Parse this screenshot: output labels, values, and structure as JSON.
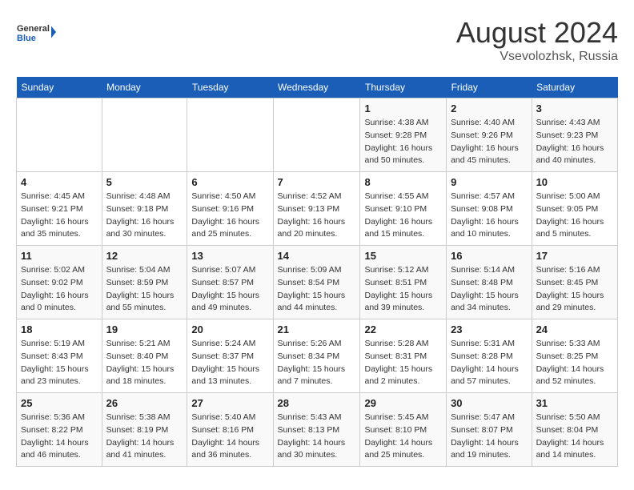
{
  "header": {
    "logo_general": "General",
    "logo_blue": "Blue",
    "month_year": "August 2024",
    "location": "Vsevolozhsk, Russia"
  },
  "days_of_week": [
    "Sunday",
    "Monday",
    "Tuesday",
    "Wednesday",
    "Thursday",
    "Friday",
    "Saturday"
  ],
  "weeks": [
    [
      {
        "day": "",
        "info": ""
      },
      {
        "day": "",
        "info": ""
      },
      {
        "day": "",
        "info": ""
      },
      {
        "day": "",
        "info": ""
      },
      {
        "day": "1",
        "info": "Sunrise: 4:38 AM\nSunset: 9:28 PM\nDaylight: 16 hours\nand 50 minutes."
      },
      {
        "day": "2",
        "info": "Sunrise: 4:40 AM\nSunset: 9:26 PM\nDaylight: 16 hours\nand 45 minutes."
      },
      {
        "day": "3",
        "info": "Sunrise: 4:43 AM\nSunset: 9:23 PM\nDaylight: 16 hours\nand 40 minutes."
      }
    ],
    [
      {
        "day": "4",
        "info": "Sunrise: 4:45 AM\nSunset: 9:21 PM\nDaylight: 16 hours\nand 35 minutes."
      },
      {
        "day": "5",
        "info": "Sunrise: 4:48 AM\nSunset: 9:18 PM\nDaylight: 16 hours\nand 30 minutes."
      },
      {
        "day": "6",
        "info": "Sunrise: 4:50 AM\nSunset: 9:16 PM\nDaylight: 16 hours\nand 25 minutes."
      },
      {
        "day": "7",
        "info": "Sunrise: 4:52 AM\nSunset: 9:13 PM\nDaylight: 16 hours\nand 20 minutes."
      },
      {
        "day": "8",
        "info": "Sunrise: 4:55 AM\nSunset: 9:10 PM\nDaylight: 16 hours\nand 15 minutes."
      },
      {
        "day": "9",
        "info": "Sunrise: 4:57 AM\nSunset: 9:08 PM\nDaylight: 16 hours\nand 10 minutes."
      },
      {
        "day": "10",
        "info": "Sunrise: 5:00 AM\nSunset: 9:05 PM\nDaylight: 16 hours\nand 5 minutes."
      }
    ],
    [
      {
        "day": "11",
        "info": "Sunrise: 5:02 AM\nSunset: 9:02 PM\nDaylight: 16 hours\nand 0 minutes."
      },
      {
        "day": "12",
        "info": "Sunrise: 5:04 AM\nSunset: 8:59 PM\nDaylight: 15 hours\nand 55 minutes."
      },
      {
        "day": "13",
        "info": "Sunrise: 5:07 AM\nSunset: 8:57 PM\nDaylight: 15 hours\nand 49 minutes."
      },
      {
        "day": "14",
        "info": "Sunrise: 5:09 AM\nSunset: 8:54 PM\nDaylight: 15 hours\nand 44 minutes."
      },
      {
        "day": "15",
        "info": "Sunrise: 5:12 AM\nSunset: 8:51 PM\nDaylight: 15 hours\nand 39 minutes."
      },
      {
        "day": "16",
        "info": "Sunrise: 5:14 AM\nSunset: 8:48 PM\nDaylight: 15 hours\nand 34 minutes."
      },
      {
        "day": "17",
        "info": "Sunrise: 5:16 AM\nSunset: 8:45 PM\nDaylight: 15 hours\nand 29 minutes."
      }
    ],
    [
      {
        "day": "18",
        "info": "Sunrise: 5:19 AM\nSunset: 8:43 PM\nDaylight: 15 hours\nand 23 minutes."
      },
      {
        "day": "19",
        "info": "Sunrise: 5:21 AM\nSunset: 8:40 PM\nDaylight: 15 hours\nand 18 minutes."
      },
      {
        "day": "20",
        "info": "Sunrise: 5:24 AM\nSunset: 8:37 PM\nDaylight: 15 hours\nand 13 minutes."
      },
      {
        "day": "21",
        "info": "Sunrise: 5:26 AM\nSunset: 8:34 PM\nDaylight: 15 hours\nand 7 minutes."
      },
      {
        "day": "22",
        "info": "Sunrise: 5:28 AM\nSunset: 8:31 PM\nDaylight: 15 hours\nand 2 minutes."
      },
      {
        "day": "23",
        "info": "Sunrise: 5:31 AM\nSunset: 8:28 PM\nDaylight: 14 hours\nand 57 minutes."
      },
      {
        "day": "24",
        "info": "Sunrise: 5:33 AM\nSunset: 8:25 PM\nDaylight: 14 hours\nand 52 minutes."
      }
    ],
    [
      {
        "day": "25",
        "info": "Sunrise: 5:36 AM\nSunset: 8:22 PM\nDaylight: 14 hours\nand 46 minutes."
      },
      {
        "day": "26",
        "info": "Sunrise: 5:38 AM\nSunset: 8:19 PM\nDaylight: 14 hours\nand 41 minutes."
      },
      {
        "day": "27",
        "info": "Sunrise: 5:40 AM\nSunset: 8:16 PM\nDaylight: 14 hours\nand 36 minutes."
      },
      {
        "day": "28",
        "info": "Sunrise: 5:43 AM\nSunset: 8:13 PM\nDaylight: 14 hours\nand 30 minutes."
      },
      {
        "day": "29",
        "info": "Sunrise: 5:45 AM\nSunset: 8:10 PM\nDaylight: 14 hours\nand 25 minutes."
      },
      {
        "day": "30",
        "info": "Sunrise: 5:47 AM\nSunset: 8:07 PM\nDaylight: 14 hours\nand 19 minutes."
      },
      {
        "day": "31",
        "info": "Sunrise: 5:50 AM\nSunset: 8:04 PM\nDaylight: 14 hours\nand 14 minutes."
      }
    ]
  ]
}
